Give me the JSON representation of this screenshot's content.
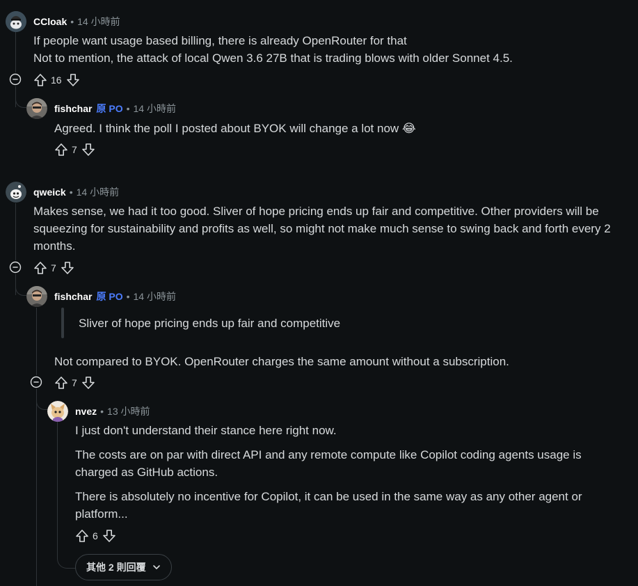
{
  "op_label": "原 PO",
  "separator": "•",
  "comments": {
    "c1": {
      "author": "CCloak",
      "time": "14 小時前",
      "lines": [
        "If people want usage based billing, there is already OpenRouter for that",
        "Not to mention, the attack of local Qwen 3.6 27B that is trading blows with older Sonnet 4.5."
      ],
      "votes": "16"
    },
    "c2": {
      "author": "fishchar",
      "time": "14 小時前",
      "text": "Agreed. I think the poll I posted about BYOK will change a lot now 😂",
      "votes": "7"
    },
    "c3": {
      "author": "qweick",
      "time": "14 小時前",
      "lines": [
        "Makes sense, we had it too good. Sliver of hope pricing ends up fair and competitive. Other providers will be",
        "squeezing for sustainability and profits as well, so might not make much sense to swing back and forth every 2",
        "months."
      ],
      "votes": "7"
    },
    "c4": {
      "author": "fishchar",
      "time": "14 小時前",
      "quote": "Sliver of hope pricing ends up fair and competitive",
      "text": "Not compared to BYOK. OpenRouter charges the same amount without a subscription.",
      "votes": "7"
    },
    "c5": {
      "author": "nvez",
      "time": "13 小時前",
      "p1": "I just don't understand their stance here right now.",
      "p2": [
        "The costs are on par with direct API and any remote compute like Copilot coding agents usage is",
        "charged as GitHub actions."
      ],
      "p3": [
        "There is absolutely no incentive for Copilot, it can be used in the same way as any other agent or",
        "platform..."
      ],
      "votes": "6"
    }
  },
  "more_replies_label": "其他 2 則回覆"
}
